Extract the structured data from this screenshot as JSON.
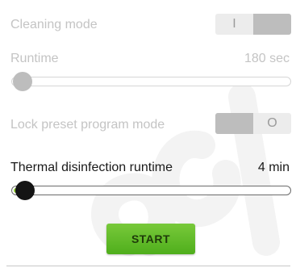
{
  "cleaning_mode": {
    "label": "Cleaning mode",
    "toggle_on_symbol": "I"
  },
  "runtime": {
    "label": "Runtime",
    "value": "180 sec",
    "slider_level": 0.0
  },
  "lock_preset": {
    "label": "Lock preset program mode",
    "toggle_off_symbol": "O"
  },
  "thermal": {
    "label": "Thermal disinfection runtime",
    "value": "4 min",
    "slider_level": 0.05
  },
  "start_button": {
    "label": "START"
  },
  "colors": {
    "accent_green": "#5bb82a",
    "disabled_gray": "#c4c4c4",
    "thumb_active": "#141414"
  }
}
